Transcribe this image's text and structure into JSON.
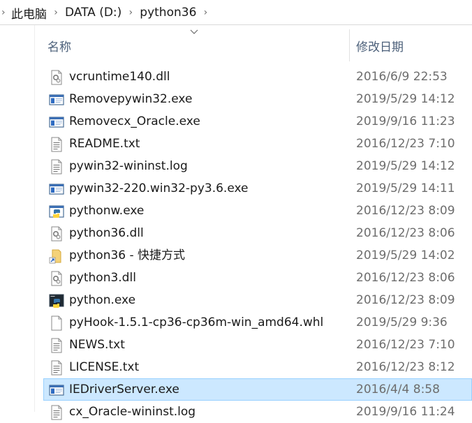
{
  "breadcrumb": {
    "items": [
      "此电脑",
      "DATA (D:)",
      "python36"
    ]
  },
  "columns": {
    "name": "名称",
    "date": "修改日期"
  },
  "files": [
    {
      "name": "vcruntime140.dll",
      "date": "2016/6/9 22:53",
      "icon": "dll-file-icon"
    },
    {
      "name": "Removepywin32.exe",
      "date": "2019/5/29 14:12",
      "icon": "application-icon"
    },
    {
      "name": "Removecx_Oracle.exe",
      "date": "2019/9/16 11:23",
      "icon": "application-icon"
    },
    {
      "name": "README.txt",
      "date": "2016/12/23 7:10",
      "icon": "text-file-icon"
    },
    {
      "name": "pywin32-wininst.log",
      "date": "2019/5/29 14:12",
      "icon": "text-file-icon"
    },
    {
      "name": "pywin32-220.win32-py3.6.exe",
      "date": "2019/5/29 14:11",
      "icon": "application-icon"
    },
    {
      "name": "pythonw.exe",
      "date": "2016/12/23 8:09",
      "icon": "python-window-icon"
    },
    {
      "name": "python36.dll",
      "date": "2016/12/23 8:06",
      "icon": "dll-file-icon"
    },
    {
      "name": "python36 - 快捷方式",
      "date": "2019/5/29 14:02",
      "icon": "folder-shortcut-icon"
    },
    {
      "name": "python3.dll",
      "date": "2016/12/23 8:06",
      "icon": "dll-file-icon"
    },
    {
      "name": "python.exe",
      "date": "2016/12/23 8:09",
      "icon": "python-console-icon"
    },
    {
      "name": "pyHook-1.5.1-cp36-cp36m-win_amd64.whl",
      "date": "2019/5/29 9:36",
      "icon": "blank-file-icon"
    },
    {
      "name": "NEWS.txt",
      "date": "2016/12/23 7:10",
      "icon": "text-file-icon"
    },
    {
      "name": "LICENSE.txt",
      "date": "2016/12/23 8:12",
      "icon": "text-file-icon"
    },
    {
      "name": "IEDriverServer.exe",
      "date": "2016/4/4 8:58",
      "icon": "application-icon",
      "selected": true
    },
    {
      "name": "cx_Oracle-wininst.log",
      "date": "2019/9/16 11:24",
      "icon": "text-file-icon"
    }
  ],
  "colors": {
    "selection_bg": "#cce8ff",
    "selection_border": "#99d1ff",
    "header_text": "#4c607a",
    "date_text": "#6d6d6d"
  }
}
